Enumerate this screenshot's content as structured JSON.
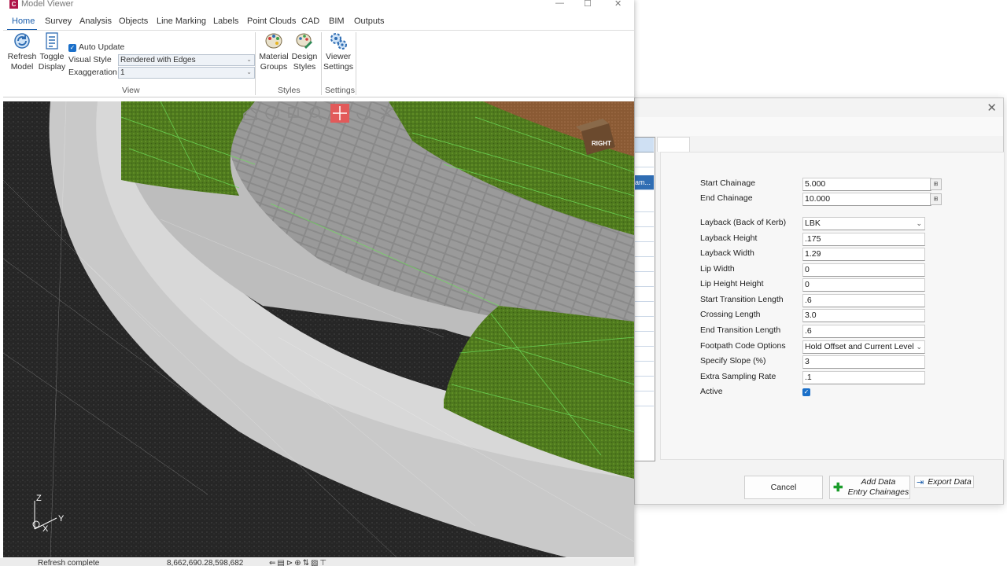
{
  "viewer": {
    "title": "Model Viewer",
    "app_icon_letter": "C",
    "window_controls": {
      "minimize": "—",
      "maximize": "☐",
      "close": "✕"
    },
    "menu": [
      "Home",
      "Survey",
      "Analysis",
      "Objects",
      "Line Marking",
      "Labels",
      "Point Clouds",
      "CAD",
      "BIM",
      "Outputs"
    ],
    "ribbon": {
      "refresh": {
        "line1": "Refresh",
        "line2": "Model"
      },
      "toggle": {
        "line1": "Toggle",
        "line2": "Display"
      },
      "auto_update_label": "Auto Update",
      "auto_update_checked": true,
      "visual_style_label": "Visual Style",
      "visual_style_value": "Rendered with Edges",
      "exaggeration_label": "Exaggeration",
      "exaggeration_value": "1",
      "material": {
        "line1": "Material",
        "line2": "Groups"
      },
      "design": {
        "line1": "Design",
        "line2": "Styles"
      },
      "viewer_settings": {
        "line1": "Viewer",
        "line2": "Settings"
      },
      "groups": [
        "View",
        "Styles",
        "Settings"
      ]
    },
    "nav_cube_label": "RIGHT",
    "axis_labels": {
      "z": "Z",
      "y": "Y",
      "x": "X"
    },
    "status": {
      "message": "Refresh complete",
      "coords": "8,662,690.28,598,682"
    }
  },
  "dialog": {
    "close": "✕",
    "selected_row_text": "am...",
    "fields": [
      {
        "label": "Start Chainage",
        "value": "5.000"
      },
      {
        "label": "End Chainage",
        "value": "10.000"
      },
      {
        "label": "Layback (Back of Kerb)",
        "value": "LBK"
      },
      {
        "label": "Layback Height",
        "value": ".175"
      },
      {
        "label": "Layback Width",
        "value": "1.29"
      },
      {
        "label": "Lip Width",
        "value": "0"
      },
      {
        "label": "Lip Height Height",
        "value": "0"
      },
      {
        "label": "Start Transition Length",
        "value": ".6"
      },
      {
        "label": "Crossing Length",
        "value": "3.0"
      },
      {
        "label": "End Transition Length",
        "value": ".6"
      },
      {
        "label": "Footpath Code Options",
        "value": "Hold Offset and Current Level"
      },
      {
        "label": "Specify Slope (%)",
        "value": "3"
      },
      {
        "label": "Extra Sampling Rate",
        "value": ".1"
      },
      {
        "label": "Active",
        "value": ""
      }
    ],
    "active_checked": true,
    "buttons": {
      "cancel": "Cancel",
      "add_line1": "Add Data",
      "add_line2": "Entry Chainages",
      "export": "Export Data"
    }
  },
  "colors": {
    "accent": "#1a5dab",
    "grass": "#4f7a1e",
    "highlight_green": "#6ee05a"
  }
}
